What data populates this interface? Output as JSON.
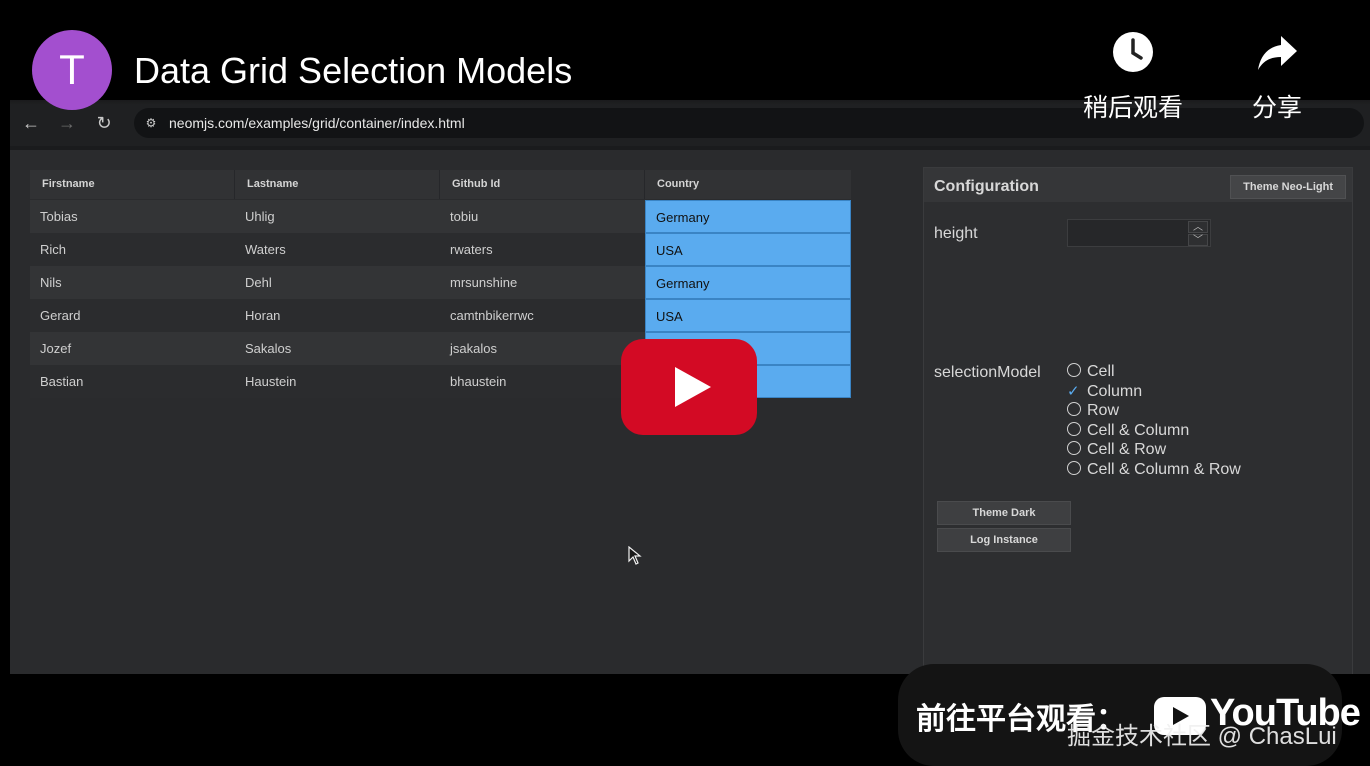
{
  "video": {
    "channel_initial": "T",
    "title": "Data Grid Selection Models",
    "watch_later_label": "稍后观看",
    "share_label": "分享",
    "goto_platform_label": "前往平台观看：",
    "youtube_word": "YouTube",
    "watermark": "掘金技术社区 @ ChasLui",
    "accent_color": "#d30a24",
    "avatar_color": "#a34fcf"
  },
  "browser": {
    "url": "neomjs.com/examples/grid/container/index.html",
    "back_icon": "arrow-left-icon",
    "forward_icon": "arrow-right-icon",
    "reload_icon": "reload-icon",
    "site_settings_icon": "tune-icon"
  },
  "grid": {
    "columns": [
      "Firstname",
      "Lastname",
      "Github Id",
      "Country"
    ],
    "rows": [
      [
        "Tobias",
        "Uhlig",
        "tobiu",
        "Germany"
      ],
      [
        "Rich",
        "Waters",
        "rwaters",
        "USA"
      ],
      [
        "Nils",
        "Dehl",
        "mrsunshine",
        "Germany"
      ],
      [
        "Gerard",
        "Horan",
        "camtnbikerrwc",
        "USA"
      ],
      [
        "Jozef",
        "Sakalos",
        "jsakalos",
        ""
      ],
      [
        "Bastian",
        "Haustein",
        "bhaustein",
        ""
      ]
    ],
    "selected_column": "Country",
    "selection_color": "#5aabef"
  },
  "config": {
    "title": "Configuration",
    "theme_button": "Theme Neo-Light",
    "height_label": "height",
    "height_value": "",
    "selection_label": "selectionModel",
    "options": [
      "Cell",
      "Column",
      "Row",
      "Cell & Column",
      "Cell & Row",
      "Cell & Column & Row"
    ],
    "selected_option": "Column",
    "theme_dark_button": "Theme Dark",
    "log_instance_button": "Log Instance"
  }
}
